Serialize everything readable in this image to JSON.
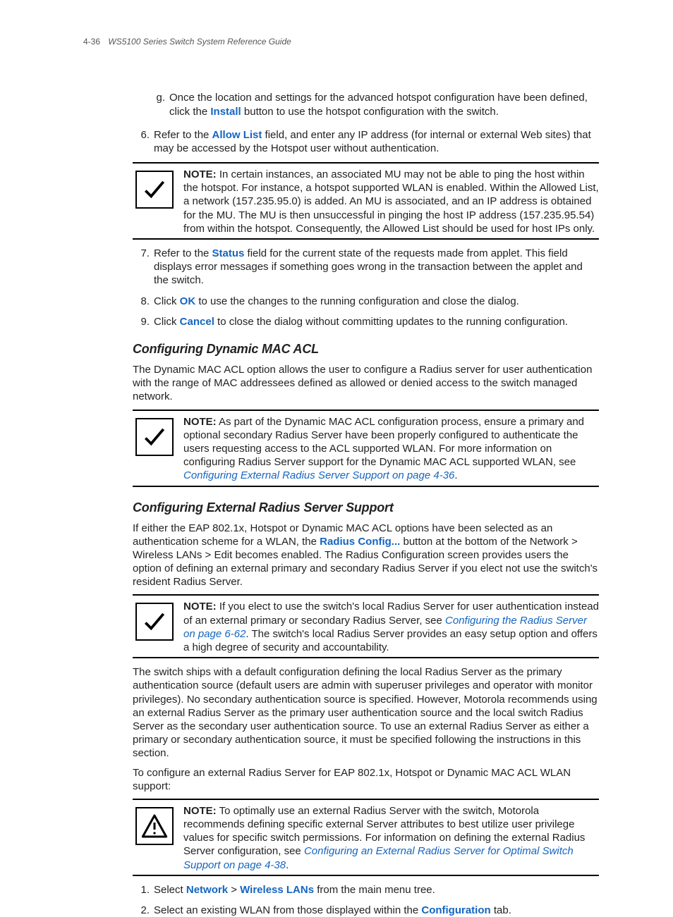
{
  "header": {
    "page_number": "4-36",
    "title": "WS5100 Series Switch System Reference Guide"
  },
  "substep_g": {
    "marker": "g.",
    "text_before": "Once the location and settings for the advanced hotspot configuration have been defined, click the ",
    "kw": "Install",
    "text_after": " button to use the hotspot configuration with the switch."
  },
  "step6": {
    "marker": "6.",
    "t1": "Refer to the ",
    "kw": "Allow List",
    "t2": " field, and enter any IP address (for internal or external Web sites) that may be accessed by the Hotspot user without authentication."
  },
  "note1": {
    "label": "NOTE:",
    "text": " In certain instances, an associated MU may not be able to ping the host within the hotspot. For instance, a hotspot supported WLAN is enabled. Within the Allowed List, a network (157.235.95.0) is added. An MU is associated, and an IP address is obtained for the MU. The MU is then unsuccessful in pinging the host IP address (157.235.95.54) from within the hotspot. Consequently, the Allowed List should be used for host IPs only."
  },
  "step7": {
    "marker": "7.",
    "t1": "Refer to the ",
    "kw": "Status",
    "t2": " field for the current state of the requests made from applet. This field displays error messages if something goes wrong in the transaction between the applet and the switch."
  },
  "step8": {
    "marker": "8.",
    "t1": "Click ",
    "kw": "OK",
    "t2": " to use the changes to the running configuration and close the dialog."
  },
  "step9": {
    "marker": "9.",
    "t1": "Click ",
    "kw": "Cancel",
    "t2": " to close the dialog without committing updates to the running configuration."
  },
  "h_mac": "Configuring Dynamic MAC ACL",
  "mac_intro": "The Dynamic MAC ACL option allows the user to configure a Radius server for user authentication with the range of MAC addressees defined as allowed or denied access to the switch managed network.",
  "note2": {
    "label": "NOTE:",
    "t1": " As part of the Dynamic MAC ACL configuration process, ensure a primary and optional secondary Radius Server have been properly configured to authenticate the users requesting access to the ACL supported WLAN. For more information on configuring Radius Server support for the Dynamic MAC ACL supported WLAN, see ",
    "link": "Configuring External Radius Server Support on page 4-36",
    "t2": "."
  },
  "h_ext": "Configuring External Radius Server Support",
  "ext_p1": {
    "t1": "If either the EAP 802.1x, Hotspot or Dynamic MAC ACL options have been selected as an authentication scheme for a WLAN, the ",
    "kw": "Radius Config...",
    "t2": " button at the bottom of the Network > Wireless LANs > Edit becomes enabled. The Radius Configuration screen provides users the option of defining an external primary and secondary Radius Server if you elect not use the switch's resident Radius Server."
  },
  "note3": {
    "label": "NOTE:",
    "t1": " If you elect to use the switch's local Radius Server for user authentication instead of an external primary or secondary Radius Server, see ",
    "link": "Configuring the Radius Server on page 6-62",
    "t2": ". The switch's local Radius Server provides an easy setup option and offers a high degree of security and accountability."
  },
  "ext_p2": "The switch ships with a default configuration defining the local Radius Server as the primary authentication source (default users are admin with superuser privileges and operator with monitor privileges). No secondary authentication source is specified. However, Motorola recommends using an external Radius Server as the primary user authentication source and the local switch Radius Server as the secondary user authentication source. To use an external Radius Server as either a primary or secondary authentication source, it must be specified following the instructions in this section.",
  "ext_p3": "To configure an external Radius Server for EAP 802.1x, Hotspot or Dynamic MAC ACL WLAN support:",
  "note4": {
    "label": "NOTE:",
    "t1": " To optimally use an external Radius Server with the switch, Motorola recommends defining specific external Server attributes to best utilize user privilege values for specific switch permissions. For information on defining the external Radius Server configuration, see ",
    "link": "Configuring an External Radius Server for Optimal Switch Support on page 4-38",
    "t2": "."
  },
  "step_e1": {
    "marker": "1.",
    "t1": "Select ",
    "kw1": "Network",
    "sep": " > ",
    "kw2": "Wireless LANs",
    "t2": " from the main menu tree."
  },
  "step_e2": {
    "marker": "2.",
    "t1": "Select an existing WLAN from those displayed within the ",
    "kw": "Configuration",
    "t2": " tab."
  }
}
